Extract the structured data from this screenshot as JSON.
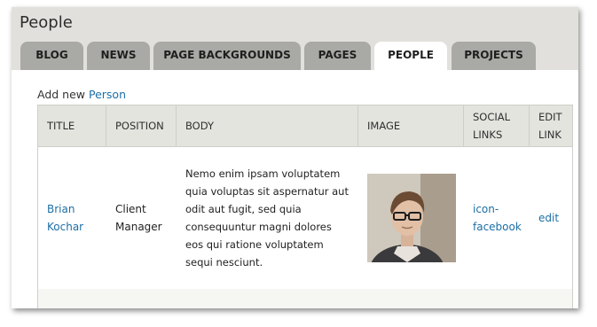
{
  "page": {
    "title": "People"
  },
  "tabs": [
    {
      "label": "BLOG",
      "active": false
    },
    {
      "label": "NEWS",
      "active": false
    },
    {
      "label": "PAGE BACKGROUNDS",
      "active": false
    },
    {
      "label": "PAGES",
      "active": false
    },
    {
      "label": "PEOPLE",
      "active": true
    },
    {
      "label": "PROJECTS",
      "active": false
    }
  ],
  "add_new": {
    "prefix": "Add new",
    "link": "Person"
  },
  "table": {
    "headers": {
      "title": "TITLE",
      "position": "POSITION",
      "body": "BODY",
      "image": "IMAGE",
      "social_links": "SOCIAL LINKS",
      "edit_link": "EDIT LINK"
    },
    "rows": [
      {
        "title": "Brian Kochar",
        "position": "Client Manager",
        "body": "Nemo enim ipsam voluptatem quia voluptas sit aspernatur aut odit aut fugit, sed quia consequuntur magni dolores eos qui ratione voluptatem sequi nesciunt.",
        "image_alt": "person-photo",
        "social_link": "icon-facebook",
        "edit": "edit"
      }
    ]
  },
  "colors": {
    "link": "#1d6fa5",
    "tab_inactive": "#a9a9a5",
    "header_band": "#e1e0dc"
  }
}
